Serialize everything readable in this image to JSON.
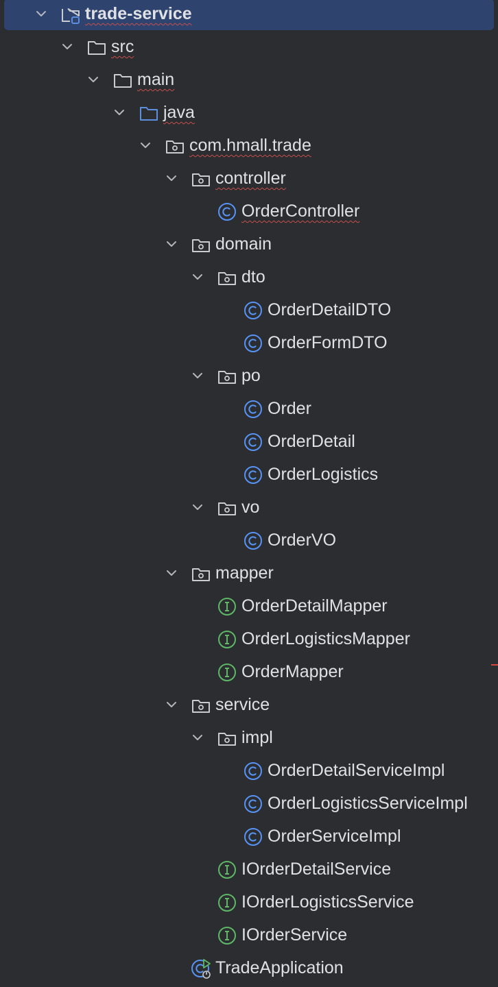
{
  "colors": {
    "background": "#2b2d30",
    "selection": "#2e436e",
    "text": "#dfe1e5",
    "chevron": "#b4b8bf",
    "folder_outline": "#c9ccd1",
    "source_folder": "#5c8fdf",
    "class_icon": "#5794f5",
    "interface_icon": "#5fb865",
    "error_underline": "#c94f4f"
  },
  "project_tree": {
    "items": [
      {
        "label": "trade-service",
        "depth": 0,
        "icon": "module-folder-icon",
        "expanded": true,
        "selected": true,
        "bold": true,
        "squiggle": true
      },
      {
        "label": "src",
        "depth": 1,
        "icon": "folder-icon",
        "expanded": true,
        "squiggle": true
      },
      {
        "label": "main",
        "depth": 2,
        "icon": "folder-icon",
        "expanded": true,
        "squiggle": true
      },
      {
        "label": "java",
        "depth": 3,
        "icon": "source-folder-icon",
        "expanded": true,
        "squiggle": true
      },
      {
        "label": "com.hmall.trade",
        "depth": 4,
        "icon": "package-icon",
        "expanded": true,
        "squiggle": true
      },
      {
        "label": "controller",
        "depth": 5,
        "icon": "package-icon",
        "expanded": true,
        "squiggle": true
      },
      {
        "label": "OrderController",
        "depth": 6,
        "icon": "class-icon",
        "squiggle": true
      },
      {
        "label": "domain",
        "depth": 5,
        "icon": "package-icon",
        "expanded": true
      },
      {
        "label": "dto",
        "depth": 6,
        "icon": "package-icon",
        "expanded": true
      },
      {
        "label": "OrderDetailDTO",
        "depth": 7,
        "icon": "class-icon"
      },
      {
        "label": "OrderFormDTO",
        "depth": 7,
        "icon": "class-icon"
      },
      {
        "label": "po",
        "depth": 6,
        "icon": "package-icon",
        "expanded": true
      },
      {
        "label": "Order",
        "depth": 7,
        "icon": "class-icon"
      },
      {
        "label": "OrderDetail",
        "depth": 7,
        "icon": "class-icon"
      },
      {
        "label": "OrderLogistics",
        "depth": 7,
        "icon": "class-icon"
      },
      {
        "label": "vo",
        "depth": 6,
        "icon": "package-icon",
        "expanded": true
      },
      {
        "label": "OrderVO",
        "depth": 7,
        "icon": "class-icon"
      },
      {
        "label": "mapper",
        "depth": 5,
        "icon": "package-icon",
        "expanded": true
      },
      {
        "label": "OrderDetailMapper",
        "depth": 6,
        "icon": "interface-icon"
      },
      {
        "label": "OrderLogisticsMapper",
        "depth": 6,
        "icon": "interface-icon"
      },
      {
        "label": "OrderMapper",
        "depth": 6,
        "icon": "interface-icon"
      },
      {
        "label": "service",
        "depth": 5,
        "icon": "package-icon",
        "expanded": true
      },
      {
        "label": "impl",
        "depth": 6,
        "icon": "package-icon",
        "expanded": true
      },
      {
        "label": "OrderDetailServiceImpl",
        "depth": 7,
        "icon": "class-icon"
      },
      {
        "label": "OrderLogisticsServiceImpl",
        "depth": 7,
        "icon": "class-icon"
      },
      {
        "label": "OrderServiceImpl",
        "depth": 7,
        "icon": "class-icon"
      },
      {
        "label": "IOrderDetailService",
        "depth": 6,
        "icon": "interface-icon"
      },
      {
        "label": "IOrderLogisticsService",
        "depth": 6,
        "icon": "interface-icon"
      },
      {
        "label": "IOrderService",
        "depth": 6,
        "icon": "interface-icon"
      },
      {
        "label": "TradeApplication",
        "depth": 5,
        "icon": "spring-boot-class-icon"
      }
    ]
  }
}
